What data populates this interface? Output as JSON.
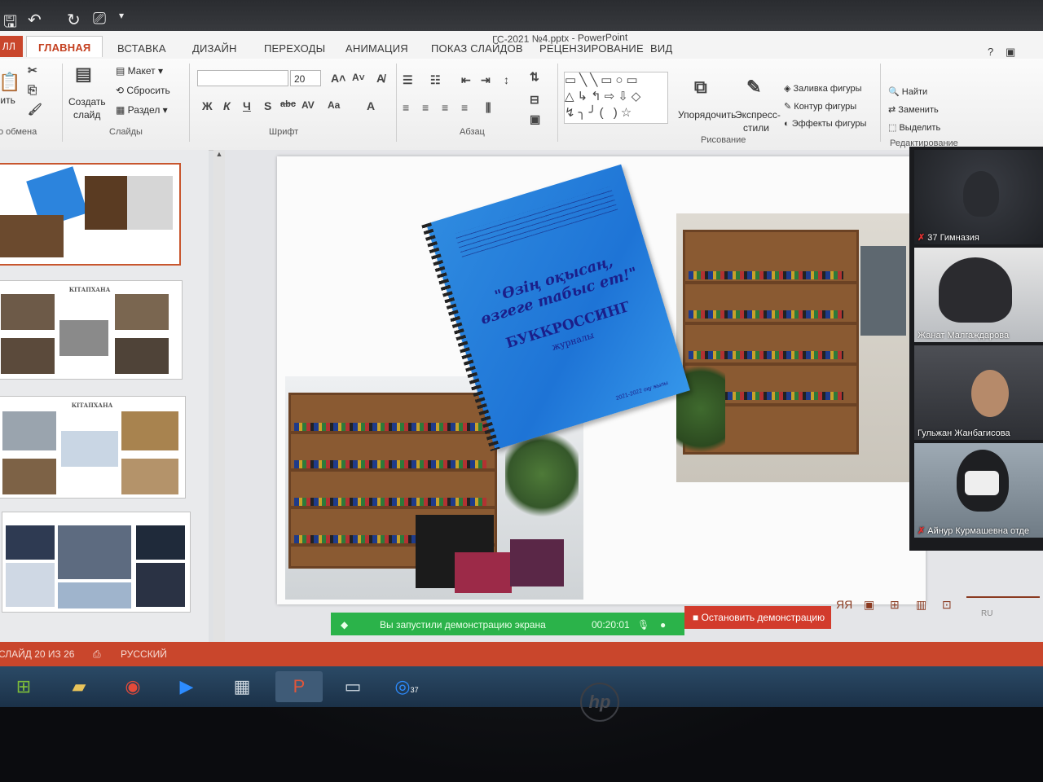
{
  "window": {
    "title": "ГС-2021 №4.pptx - PowerPoint",
    "help": "?"
  },
  "tabs": {
    "file": "ЛЛ",
    "home": "ГЛАВНАЯ",
    "insert": "ВСТАВКА",
    "design": "ДИЗАЙН",
    "transitions": "ПЕРЕХОДЫ",
    "animation": "АНИМАЦИЯ",
    "slideshow": "ПОКАЗ СЛАЙДОВ",
    "review": "РЕЦЕНЗИРОВАНИЕ",
    "view": "ВИД"
  },
  "ribbon": {
    "paste": "вить",
    "clipboard_group": "о обмена",
    "new_slide_1": "Создать",
    "new_slide_2": "слайд",
    "layout": "Макет",
    "reset": "Сбросить",
    "section": "Раздел",
    "slides_group": "Слайды",
    "font_name": "",
    "font_size": "20",
    "font_group": "Шрифт",
    "paragraph_group": "Абзац",
    "arrange": "Упорядочить",
    "quick_styles_1": "Экспресс-",
    "quick_styles_2": "стили",
    "drawing_group": "Рисование",
    "shape_fill": "Заливка фигуры",
    "shape_outline": "Контур фигуры",
    "shape_effects": "Эффекты фигуры",
    "find": "Найти",
    "replace": "Заменить",
    "select": "Выделить",
    "editing_group": "Редактирование",
    "bold": "Ж",
    "italic": "К",
    "underline": "Ч",
    "shadow": "S",
    "strike": "abc",
    "spacing": "AV",
    "case": "Aa",
    "color": "A"
  },
  "thumbnails": {
    "thumb2_title": "КІТАПХАНА",
    "thumb3_title": "КІТАПХАНА",
    "thumb4_title": "",
    "number": "4"
  },
  "slide": {
    "cover_title_1": "\"Өзің оқысаң,",
    "cover_title_2": "өзгеге табыс ет!\"",
    "cover_subtitle": "БУККРОССИНГ",
    "cover_caption": "журналы",
    "cover_year": "2021-2022 оқу жылы"
  },
  "zoom": {
    "participants": [
      {
        "name": "37 Гимназия",
        "muted": true
      },
      {
        "name": "Жанат Малгаждарова",
        "muted": false
      },
      {
        "name": "Гульжан Жанбагисова",
        "muted": false
      },
      {
        "name": "Айнур Курмашевна отде",
        "muted": true
      }
    ],
    "sharing_text": "Вы запустили демонстрацию экрана",
    "timer": "00:20:01",
    "stop_button": "Остановить демонстрацию"
  },
  "status": {
    "slide_counter": "СЛАЙД 20 ИЗ 26",
    "language": "РУССКИЙ",
    "notes": "ЯЯ",
    "keyboard": "RU"
  },
  "colors": {
    "accent": "#c9462c",
    "share_green": "#2bb34a",
    "stop_red": "#d23b2c"
  },
  "taskbar": {
    "items": [
      "start-orb",
      "file-explorer",
      "chrome",
      "zoom",
      "calculator",
      "powerpoint",
      "camera",
      "chrome-badge"
    ],
    "chrome_badge": "37"
  }
}
